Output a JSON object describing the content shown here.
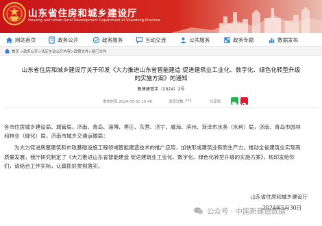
{
  "header": {
    "site_name": "山东省住房和城乡建设厅",
    "site_subtitle": "Housing and Urban-Rural Development Department of Shandong Province"
  },
  "nav": {
    "items": [
      {
        "label": "网站首页",
        "icon": "home-icon"
      },
      {
        "label": "政务公开",
        "icon": "document-icon"
      },
      {
        "label": "政务服务",
        "icon": "service-icon"
      },
      {
        "label": "互动交流",
        "icon": "chat-icon"
      },
      {
        "label": "公共服务",
        "icon": "people-icon"
      },
      {
        "label": "政务专题",
        "icon": "topic-icon"
      },
      {
        "label": "数据发布",
        "icon": "chart-icon"
      }
    ]
  },
  "breadcrumb": "首页 >政务公开>法定主动公开内容>政策文件>部门文件",
  "article": {
    "title_line1": "山东省住房和城乡建设厅关于印发《大力推进山东省智能建造 促进建筑业工业化、数字化、绿色化转型升级",
    "title_line2": "的实施方案》的通知",
    "doc_number": "鲁建建管字〔2024〕2号",
    "publish_time": "发布时间:2024-05-31 10:48",
    "views_label": "浏览次数:",
    "views": "221",
    "share_label": "分享到",
    "addressees_line1": "各市住房城乡建设局、城管局，济南、青岛、淄博、枣庄、东营、济宁、威海、滨州、菏泽市水务（水利）局，济南、青岛市园林",
    "addressees_line2": "和林业（绿化）局，济南市城乡交通运输局：",
    "para_line1": "为大力促进房屋建筑和市政基础设施工程领域智能建造技术的推广应用，加快形成建筑业新质生产力，推动全省建筑业实现高",
    "para_line2": "质量发展，我厅研究制定了《大力推进山东省智能建造 促进建筑业工业化、数字化、绿色化转型升级的实施方案》，现印发给你",
    "para_line3": "们，请结合工作实际，认真抓好贯彻落实。",
    "signature_org": "山东省住房和城乡建设厅",
    "signature_date": "2024年5月30日"
  },
  "watermark": {
    "text": "公众号 · 中国新建造数据"
  },
  "colors": {
    "header_red": "#c8141a",
    "nav_icon_blue": "#2f7fd6",
    "wechat_green": "#23b14d"
  }
}
